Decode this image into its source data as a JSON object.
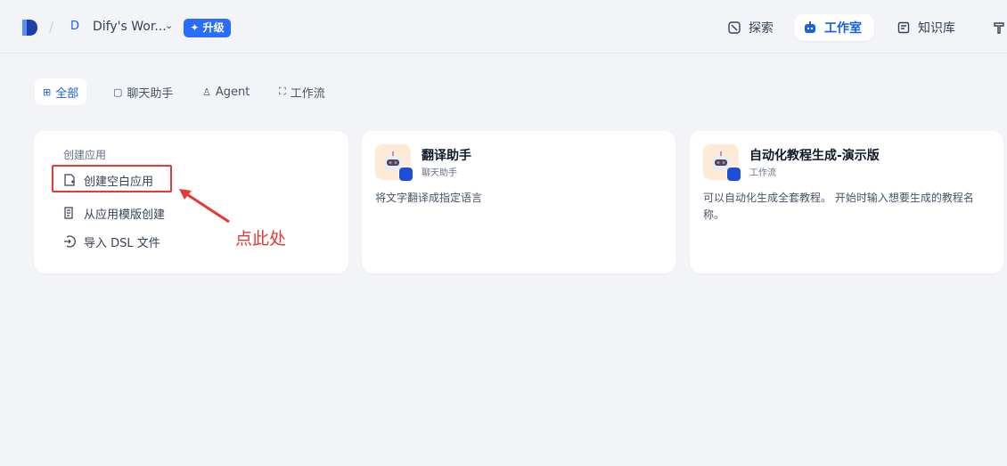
{
  "header": {
    "workspace_initial": "D",
    "workspace_name": "Dify's Wor...",
    "upgrade_label": "升级",
    "nav": {
      "explore": "探索",
      "studio": "工作室",
      "knowledge": "知识库"
    }
  },
  "tabs": {
    "all": "全部",
    "chat": "聊天助手",
    "agent": "Agent",
    "workflow": "工作流"
  },
  "create": {
    "title": "创建应用",
    "blank": "创建空白应用",
    "template": "从应用模版创建",
    "import_dsl": "导入 DSL 文件"
  },
  "apps": [
    {
      "name": "翻译助手",
      "type": "聊天助手",
      "description": "将文字翻译成指定语言"
    },
    {
      "name": "自动化教程生成-演示版",
      "type": "工作流",
      "description": "可以自动化生成全套教程。 开始时输入想要生成的教程名称。"
    }
  ],
  "annotation": {
    "text": "点此处"
  },
  "colors": {
    "accent": "#155eef",
    "upgrade": "#296dff",
    "annotation": "#e53935",
    "background": "#f2f4f7"
  }
}
